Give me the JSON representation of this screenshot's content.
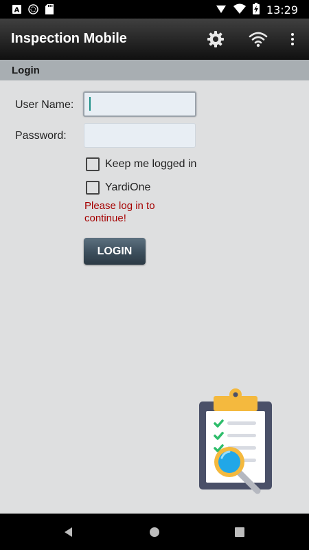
{
  "status_bar": {
    "time": "13:29",
    "left_icons": [
      "text-a-icon",
      "circle-dots-icon",
      "sd-card-icon"
    ],
    "right_icons": [
      "data-saver-icon",
      "wifi-signal-icon",
      "battery-charging-icon"
    ]
  },
  "app_bar": {
    "title": "Inspection Mobile",
    "icons": [
      "gear-icon",
      "wifi-icon",
      "more-vert-icon"
    ]
  },
  "section": {
    "title": "Login"
  },
  "form": {
    "username_label": "User Name:",
    "username_value": "",
    "password_label": "Password:",
    "password_value": "",
    "keep_logged_in_label": "Keep me logged in",
    "keep_logged_in_checked": false,
    "yardione_label": "YardiOne",
    "yardione_checked": false,
    "error_message": "Please log in to continue!",
    "login_button": "LOGIN"
  },
  "illustration": "clipboard-magnifier-icon",
  "nav_bar": {
    "buttons": [
      "back-icon",
      "home-icon",
      "recents-icon"
    ]
  },
  "colors": {
    "app_bar": "#2a2a2a",
    "section_header": "#a8aeb2",
    "content_bg": "#dedfe0",
    "error_text": "#a50000",
    "login_button": "#3c4e5c"
  }
}
